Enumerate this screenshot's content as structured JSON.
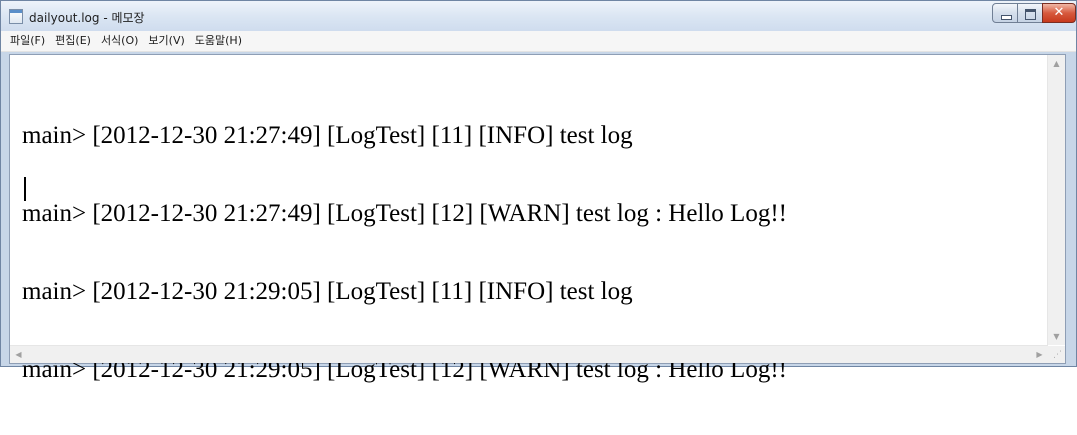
{
  "window": {
    "title": "dailyout.log - 메모장",
    "icon": "notepad-icon",
    "buttons": {
      "minimize_icon": "minimize-icon",
      "maximize_icon": "maximize-icon",
      "close_glyph": "✕"
    }
  },
  "menu": {
    "items": [
      {
        "label": "파일(F)"
      },
      {
        "label": "편집(E)"
      },
      {
        "label": "서식(O)"
      },
      {
        "label": "보기(V)"
      },
      {
        "label": "도움말(H)"
      }
    ]
  },
  "editor": {
    "lines": [
      "main> [2012-12-30 21:27:49] [LogTest] [11] [INFO] test log",
      "main> [2012-12-30 21:27:49] [LogTest] [12] [WARN] test log : Hello Log!!",
      "main> [2012-12-30 21:29:05] [LogTest] [11] [INFO] test log",
      "main> [2012-12-30 21:29:05] [LogTest] [12] [WARN] test log : Hello Log!!"
    ],
    "font_color": "#000000"
  },
  "scrollbars": {
    "up_arrow": "▲",
    "down_arrow": "▼",
    "left_arrow": "◀",
    "right_arrow": "▶",
    "grip": "⋰"
  },
  "colors": {
    "titlebar": "#dbe6f3",
    "close_button": "#c7391c",
    "frame": "#c7d6e8"
  }
}
